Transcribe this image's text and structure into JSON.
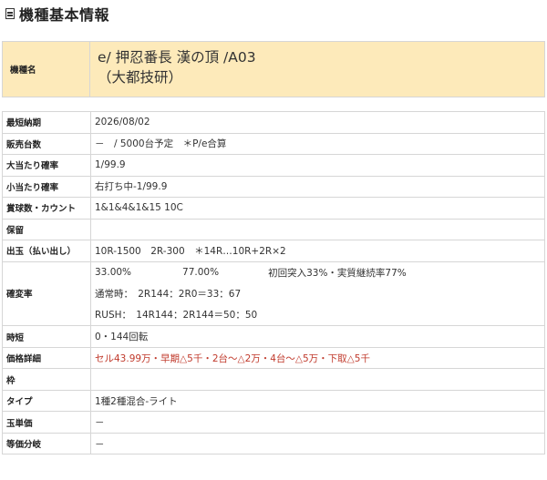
{
  "header": {
    "title": "機種基本情報",
    "icon": "document-icon"
  },
  "machine": {
    "label": "機種名",
    "name_line1": "e/ 押忍番長 漢の頂 /A03",
    "name_line2": "（大都技研）"
  },
  "specs": {
    "release_date": {
      "label": "最短納期",
      "value": "2026/08/02"
    },
    "units_sold": {
      "label": "販売台数",
      "value": "－　/ 5000台予定　＊P/e合算"
    },
    "big_prob": {
      "label": "大当たり確率",
      "value": "1/99.9"
    },
    "small_prob": {
      "label": "小当たり確率",
      "value": "右打ち中-1/99.9"
    },
    "payout_count": {
      "label": "賞球数・カウント",
      "value": "1&1&4&1&15 10C"
    },
    "hold": {
      "label": "保留",
      "value": ""
    },
    "payout": {
      "label": "出玉（払い出し）",
      "value": "10R-1500　2R-300　＊14R…10R+2R×2"
    },
    "prob_change": {
      "label": "確変率",
      "line1_a": "33.00%",
      "line1_b": "77.00%",
      "line1_c": "初回突入33%・実質継続率77%",
      "line2": "通常時：　2R144：2R0＝33：67",
      "line3": "RUSH：　14R144：2R144＝50：50"
    },
    "time_short": {
      "label": "時短",
      "value": "0・144回転"
    },
    "price": {
      "label": "価格詳細",
      "value": "セル43.99万・早期△5千・2台～△2万・4台～△5万・下取△5千"
    },
    "frame": {
      "label": "枠",
      "value": ""
    },
    "type": {
      "label": "タイプ",
      "value": "1種2種混合-ライト"
    },
    "ball_price": {
      "label": "玉単価",
      "value": "－"
    },
    "equal_split": {
      "label": "等価分岐",
      "value": "－"
    }
  },
  "colors": {
    "name_bg": "#fdeaba",
    "border": "#d6d6d6",
    "price_red": "#c0392b"
  }
}
